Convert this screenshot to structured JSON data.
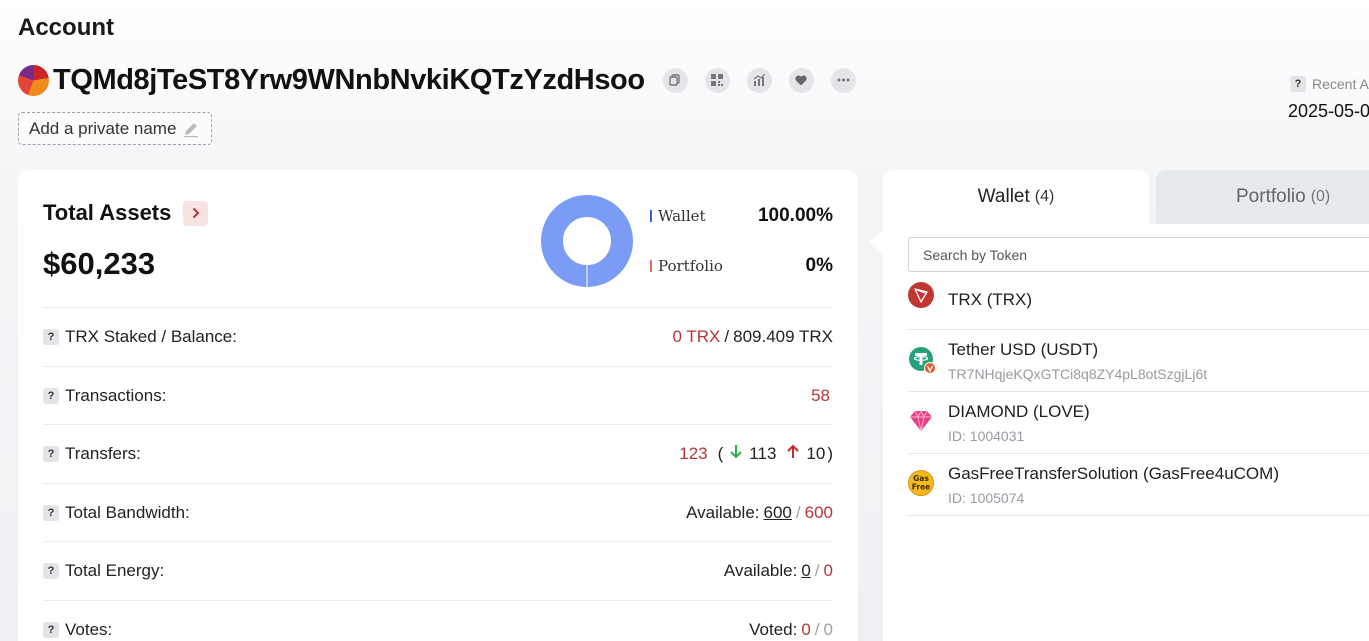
{
  "header": {
    "title": "Account",
    "address": "TQMd8jTeST8Yrw9WNnbNvkiKQTzYzdHsoo",
    "private_name_placeholder": "Add a private name",
    "recent_label": "Recent A",
    "recent_date": "2025-05-0",
    "action_icons": [
      "copy-icon",
      "qr-code-icon",
      "chart-icon",
      "heart-icon",
      "more-icon"
    ]
  },
  "assets": {
    "title": "Total Assets",
    "total": "$60,233",
    "legend": [
      {
        "label": "Wallet",
        "pct": "100.00%",
        "color": "#7b9cf5"
      },
      {
        "label": "Portfolio",
        "pct": "0%",
        "color": "#e3a1a1"
      }
    ],
    "chart_data": {
      "type": "pie",
      "categories": [
        "Wallet",
        "Portfolio"
      ],
      "values": [
        100,
        0
      ]
    },
    "rows": {
      "staked": {
        "label": "TRX Staked / Balance:",
        "staked": "0 TRX",
        "slash": "/",
        "balance": "809.409 TRX"
      },
      "transactions": {
        "label": "Transactions:",
        "value": "58"
      },
      "transfers": {
        "label": "Transfers:",
        "total": "123",
        "open": "(",
        "in": "113",
        "out": "10",
        "close": ")"
      },
      "bandwidth": {
        "label": "Total Bandwidth:",
        "prefix": "Available:",
        "available": "600",
        "slash": "/",
        "total": "600"
      },
      "energy": {
        "label": "Total Energy:",
        "prefix": "Available:",
        "available": "0",
        "slash": "/",
        "total": "0"
      },
      "votes": {
        "label": "Votes:",
        "prefix": "Voted:",
        "voted": "0",
        "slash": "/",
        "total": "0"
      }
    }
  },
  "tabs": {
    "wallet_label": "Wallet",
    "wallet_count": "(4)",
    "portfolio_label": "Portfolio",
    "portfolio_count": "(0)"
  },
  "search": {
    "placeholder": "Search by Token"
  },
  "tokens": [
    {
      "name": "TRX (TRX)",
      "sub": "",
      "icon": "trx-icon"
    },
    {
      "name": "Tether USD (USDT)",
      "sub": "TR7NHqjeKQxGTCi8q8ZY4pL8otSzgjLj6t",
      "icon": "usdt-icon"
    },
    {
      "name": "DIAMOND (LOVE)",
      "sub": "ID: 1004031",
      "icon": "diamond-icon"
    },
    {
      "name": "GasFreeTransferSolution (GasFree4uCOM)",
      "sub": "ID: 1005074",
      "icon": "gasfree-icon",
      "icon_text": "Gas Free"
    }
  ]
}
